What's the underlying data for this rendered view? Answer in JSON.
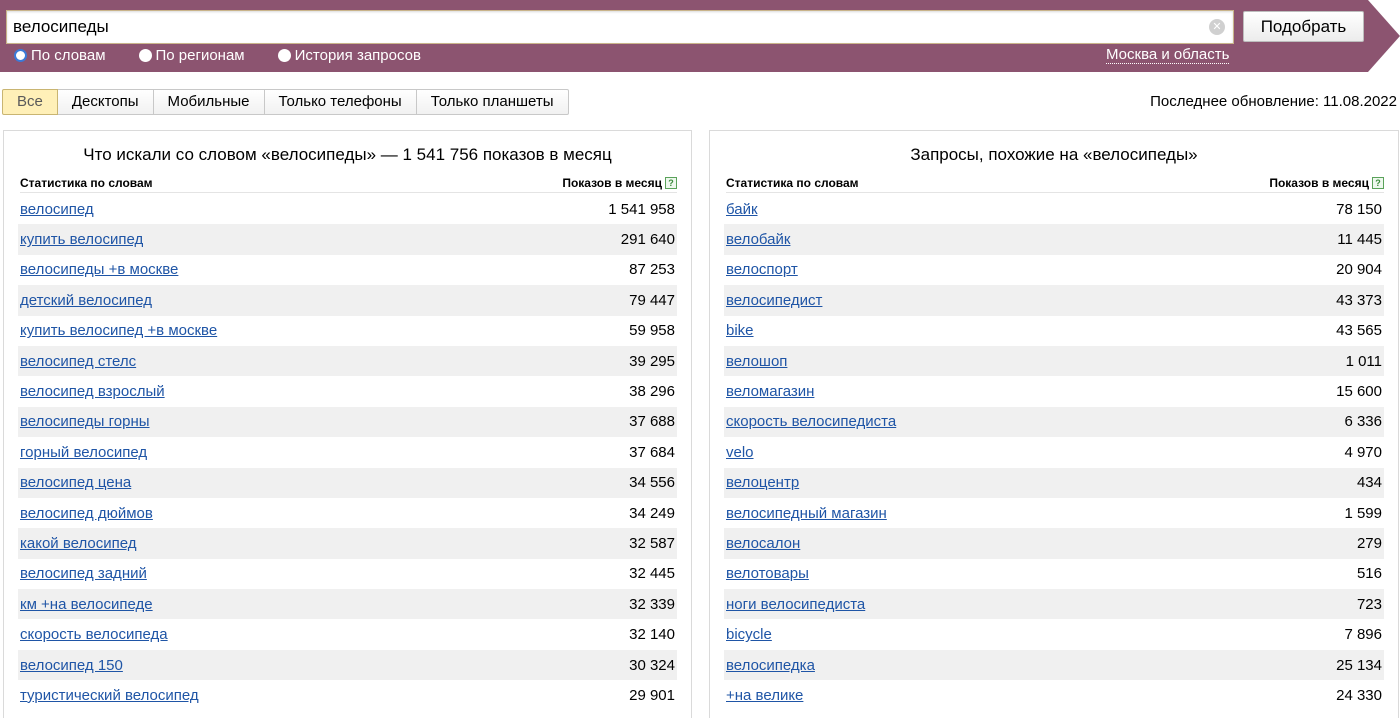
{
  "search": {
    "value": "велосипеды",
    "submit_label": "Подобрать"
  },
  "modes": [
    {
      "label": "По словам",
      "selected": true
    },
    {
      "label": "По регионам",
      "selected": false
    },
    {
      "label": "История запросов",
      "selected": false
    }
  ],
  "region": "Москва и область",
  "device_tabs": [
    {
      "label": "Все",
      "active": true
    },
    {
      "label": "Десктопы",
      "active": false
    },
    {
      "label": "Мобильные",
      "active": false
    },
    {
      "label": "Только телефоны",
      "active": false
    },
    {
      "label": "Только планшеты",
      "active": false
    }
  ],
  "last_update": "Последнее обновление: 11.08.2022",
  "left_panel": {
    "title": "Что искали со словом «велосипеды» — 1 541 756 показов в месяц",
    "col_keyword": "Статистика по словам",
    "col_count": "Показов в месяц",
    "rows": [
      {
        "keyword": "велосипед",
        "count": "1 541 958"
      },
      {
        "keyword": "купить велосипед",
        "count": "291 640"
      },
      {
        "keyword": "велосипеды +в москве",
        "count": "87 253"
      },
      {
        "keyword": "детский велосипед",
        "count": "79 447"
      },
      {
        "keyword": "купить велосипед +в москве",
        "count": "59 958"
      },
      {
        "keyword": "велосипед стелс",
        "count": "39 295"
      },
      {
        "keyword": "велосипед взрослый",
        "count": "38 296"
      },
      {
        "keyword": "велосипеды горны",
        "count": "37 688"
      },
      {
        "keyword": "горный велосипед",
        "count": "37 684"
      },
      {
        "keyword": "велосипед цена",
        "count": "34 556"
      },
      {
        "keyword": "велосипед дюймов",
        "count": "34 249"
      },
      {
        "keyword": "какой велосипед",
        "count": "32 587"
      },
      {
        "keyword": "велосипед задний",
        "count": "32 445"
      },
      {
        "keyword": "км +на велосипеде",
        "count": "32 339"
      },
      {
        "keyword": "скорость велосипеда",
        "count": "32 140"
      },
      {
        "keyword": "велосипед 150",
        "count": "30 324"
      },
      {
        "keyword": "туристический велосипед",
        "count": "29 901"
      }
    ]
  },
  "right_panel": {
    "title": "Запросы, похожие на «велосипеды»",
    "col_keyword": "Статистика по словам",
    "col_count": "Показов в месяц",
    "rows": [
      {
        "keyword": "байк",
        "count": "78 150"
      },
      {
        "keyword": "велобайк",
        "count": "11 445"
      },
      {
        "keyword": "велоспорт",
        "count": "20 904"
      },
      {
        "keyword": "велосипедист",
        "count": "43 373"
      },
      {
        "keyword": "bike",
        "count": "43 565"
      },
      {
        "keyword": "велошоп",
        "count": "1 011"
      },
      {
        "keyword": "веломагазин",
        "count": "15 600"
      },
      {
        "keyword": "скорость велосипедиста",
        "count": "6 336"
      },
      {
        "keyword": "velo",
        "count": "4 970"
      },
      {
        "keyword": "велоцентр",
        "count": "434"
      },
      {
        "keyword": "велосипедный магазин",
        "count": "1 599"
      },
      {
        "keyword": "велосалон",
        "count": "279"
      },
      {
        "keyword": "велотовары",
        "count": "516"
      },
      {
        "keyword": "ноги велосипедиста",
        "count": "723"
      },
      {
        "keyword": "bicycle",
        "count": "7 896"
      },
      {
        "keyword": "велосипедка",
        "count": "25 134"
      },
      {
        "keyword": "+на велике",
        "count": "24 330"
      }
    ]
  },
  "colors": {
    "header": "#8c5470",
    "link": "#1f55a6",
    "active_tab": "#fff0b8"
  }
}
